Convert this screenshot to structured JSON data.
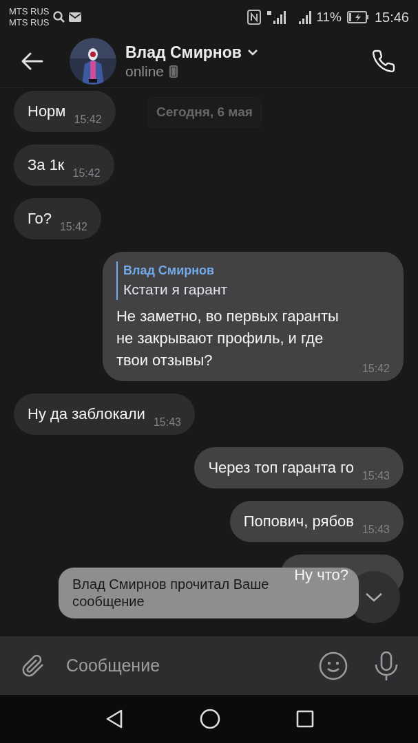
{
  "status_bar": {
    "carriers": [
      "MTS RUS",
      "MTS RUS"
    ],
    "battery": "11%",
    "time": "15:46"
  },
  "header": {
    "name": "Влад Смирнов",
    "status": "online"
  },
  "date_badge": "Сегодня, 6 мая",
  "messages": [
    {
      "kind": "incoming",
      "text": "Норм",
      "time": "15:42"
    },
    {
      "kind": "incoming",
      "text": "За 1к",
      "time": "15:42"
    },
    {
      "kind": "incoming",
      "text": "Го?",
      "time": "15:42"
    },
    {
      "kind": "outgoing",
      "reply": {
        "author": "Влад Смирнов",
        "text": "Кстати я гарант"
      },
      "text": "Не заметно, во первых гаранты не закрывают профиль, и где твои отзывы?",
      "time": "15:42"
    },
    {
      "kind": "incoming",
      "text": "Ну да заблокали",
      "time": "15:43"
    },
    {
      "kind": "outgoing",
      "text": "Через топ гаранта го",
      "time": "15:43"
    },
    {
      "kind": "outgoing",
      "text": "Попович, рябов",
      "time": "15:43"
    },
    {
      "kind": "outgoing",
      "text": "Ну что?"
    }
  ],
  "toast": "Влад Смирнов прочитал Ваше сообщение",
  "composer": {
    "placeholder": "Сообщение"
  }
}
